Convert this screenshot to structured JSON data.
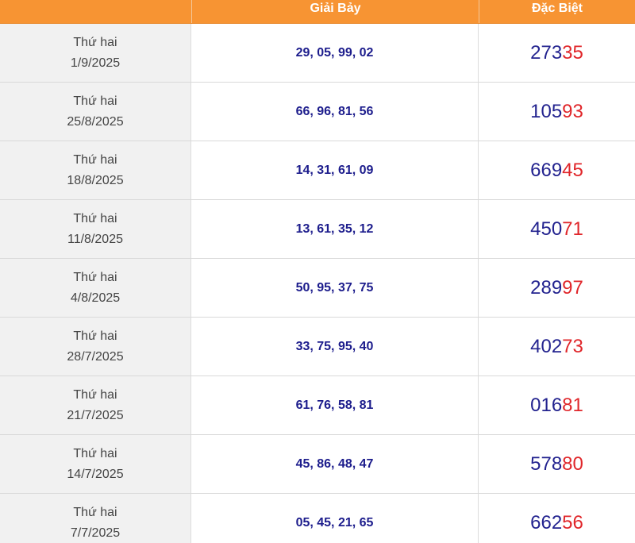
{
  "header": {
    "date_col": "",
    "giai_bay": "Giải Bảy",
    "dac_biet": "Đặc Biệt"
  },
  "rows": [
    {
      "weekday": "Thứ hai",
      "date": "1/9/2025",
      "giai_bay": "29, 05, 99, 02",
      "db_head": "273",
      "db_tail": "35"
    },
    {
      "weekday": "Thứ hai",
      "date": "25/8/2025",
      "giai_bay": "66, 96, 81, 56",
      "db_head": "105",
      "db_tail": "93"
    },
    {
      "weekday": "Thứ hai",
      "date": "18/8/2025",
      "giai_bay": "14, 31, 61, 09",
      "db_head": "669",
      "db_tail": "45"
    },
    {
      "weekday": "Thứ hai",
      "date": "11/8/2025",
      "giai_bay": "13, 61, 35, 12",
      "db_head": "450",
      "db_tail": "71"
    },
    {
      "weekday": "Thứ hai",
      "date": "4/8/2025",
      "giai_bay": "50, 95, 37, 75",
      "db_head": "289",
      "db_tail": "97"
    },
    {
      "weekday": "Thứ hai",
      "date": "28/7/2025",
      "giai_bay": "33, 75, 95, 40",
      "db_head": "402",
      "db_tail": "73"
    },
    {
      "weekday": "Thứ hai",
      "date": "21/7/2025",
      "giai_bay": "61, 76, 58, 81",
      "db_head": "016",
      "db_tail": "81"
    },
    {
      "weekday": "Thứ hai",
      "date": "14/7/2025",
      "giai_bay": "45, 86, 48, 47",
      "db_head": "578",
      "db_tail": "80"
    },
    {
      "weekday": "Thứ hai",
      "date": "7/7/2025",
      "giai_bay": "05, 45, 21, 65",
      "db_head": "662",
      "db_tail": "56"
    }
  ],
  "colors": {
    "header_bg": "#f79433",
    "header_text": "#ffffff",
    "giai_bay_text": "#1c1c8c",
    "special_head": "#23238f",
    "special_tail": "#e0262a",
    "date_bg": "#f1f1f1"
  }
}
